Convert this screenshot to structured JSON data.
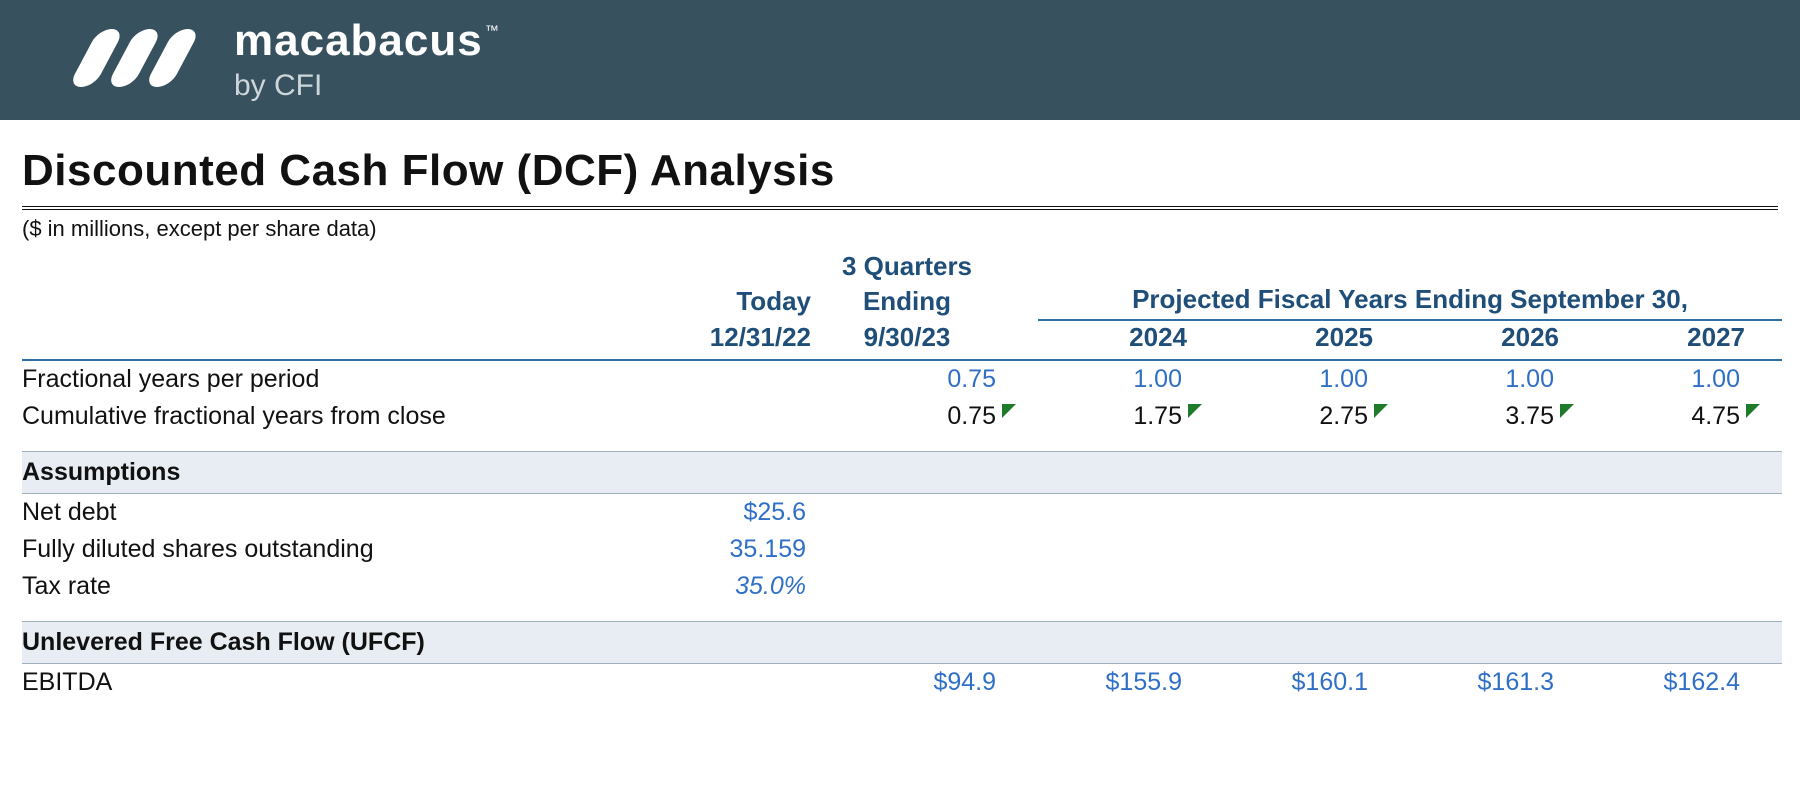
{
  "brand": {
    "name": "macabacus",
    "tm": "™",
    "byline": "by CFI"
  },
  "title": "Discounted Cash Flow (DCF) Analysis",
  "subnote": "($ in millions, except per share data)",
  "headers": {
    "today_label": "Today",
    "today_date": "12/31/22",
    "q3_label_line1": "3 Quarters",
    "q3_label_line2": "Ending",
    "q3_date": "9/30/23",
    "projected_label": "Projected Fiscal Years Ending September 30,",
    "fy_years": [
      "2024",
      "2025",
      "2026",
      "2027"
    ]
  },
  "rows": {
    "fractional_label": "Fractional years per period",
    "fractional_values": {
      "q3": "0.75",
      "fy": [
        "1.00",
        "1.00",
        "1.00",
        "1.00"
      ]
    },
    "cumulative_label": "Cumulative fractional years from close",
    "cumulative_values": {
      "q3": "0.75",
      "fy": [
        "1.75",
        "2.75",
        "3.75",
        "4.75"
      ]
    }
  },
  "sections": {
    "assumptions": "Assumptions",
    "ufcf": "Unlevered Free Cash Flow (UFCF)"
  },
  "assumptions": {
    "net_debt_label": "Net debt",
    "net_debt_value": "$25.6",
    "shares_label": "Fully diluted shares outstanding",
    "shares_value": "35.159",
    "tax_label": "Tax rate",
    "tax_value": "35.0%"
  },
  "ufcf": {
    "ebitda_label": "EBITDA",
    "ebitda_values": {
      "q3": "$94.9",
      "fy": [
        "$155.9",
        "$160.1",
        "$161.3",
        "$162.4"
      ]
    }
  }
}
